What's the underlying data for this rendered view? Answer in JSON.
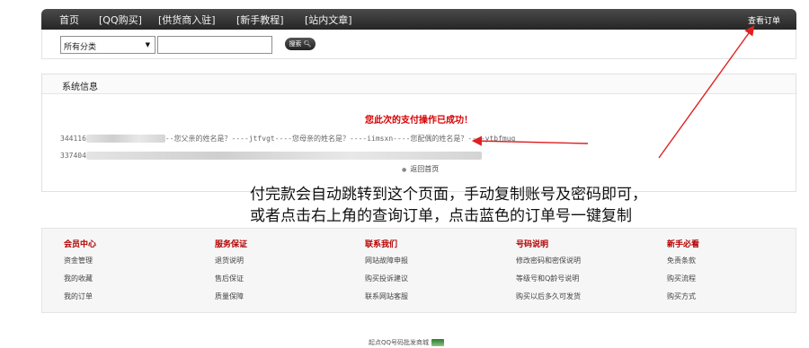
{
  "topnav": {
    "items": [
      "首页",
      "[QQ购买]",
      "[供货商入驻]",
      "[新手教程]",
      "[站内文章]"
    ],
    "order_link": "查看订单"
  },
  "search": {
    "category_value": "所有分类",
    "input_value": "",
    "button_label": "搜索"
  },
  "panel": {
    "title": "系统信息",
    "success_message": "您此次的支付操作已成功！",
    "row1": {
      "prefix": "344116",
      "text": "--您父亲的姓名是？----jtfvgt----您母亲的姓名是？----iimsxn----您配偶的姓名是？----ytbfmug"
    },
    "row2": {
      "prefix": "337404"
    },
    "back_label": "返回首页"
  },
  "instruction": {
    "line1": "付完款会自动跳转到这个页面，手动复制账号及密码即可，",
    "line2": "或者点击右上角的查询订单，点击蓝色的订单号一键复制"
  },
  "footer": {
    "columns": [
      {
        "title": "会员中心",
        "links": [
          "资金管理",
          "我的收藏",
          "我的订单"
        ]
      },
      {
        "title": "服务保证",
        "links": [
          "退货说明",
          "售后保证",
          "质量保障"
        ]
      },
      {
        "title": "联系我们",
        "links": [
          "网站故障申报",
          "购买投诉建议",
          "联系网站客服"
        ]
      },
      {
        "title": "号码说明",
        "links": [
          "修改密码和密保说明",
          "等级号和Q龄号说明",
          "购买以后多久可发货"
        ]
      },
      {
        "title": "新手必看",
        "links": [
          "免责条款",
          "购买流程",
          "购买方式"
        ]
      }
    ]
  },
  "bottom_note": "起点QQ号码批发商城",
  "colors": {
    "arrow": "#e02020",
    "nav_bg": "#333333",
    "accent_red": "#d40000"
  }
}
